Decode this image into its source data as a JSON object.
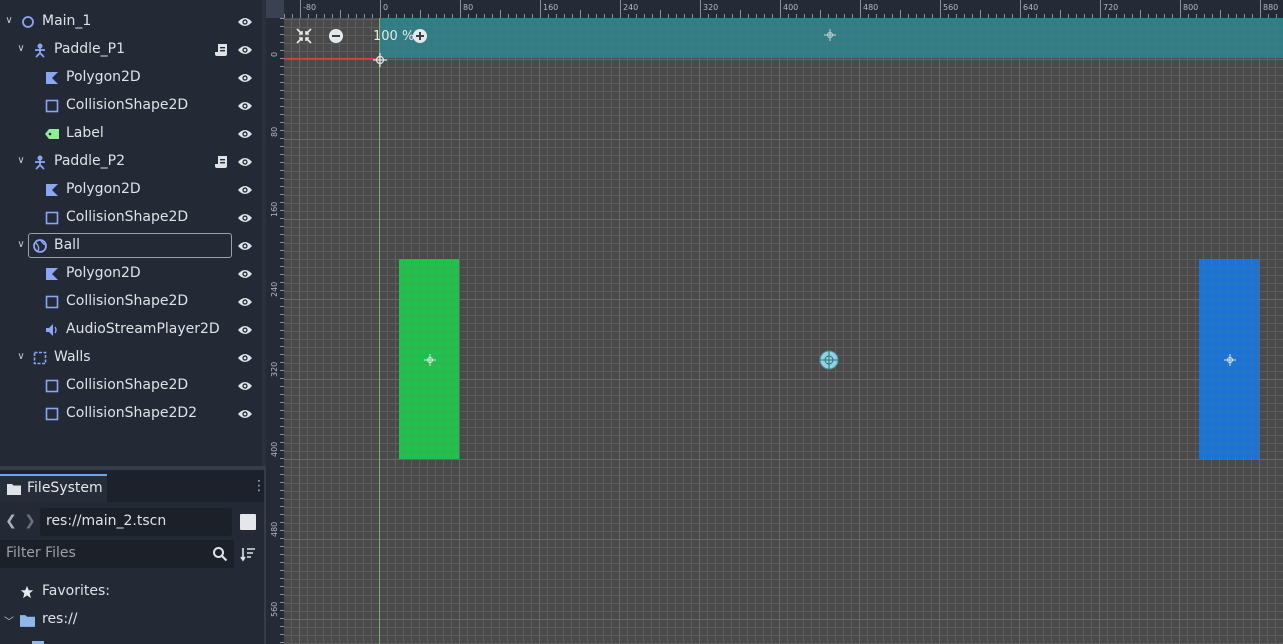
{
  "scene_tree": {
    "nodes": [
      {
        "label": "Main_1",
        "icon": "node2d-icon",
        "visible_icon": "eye-icon"
      },
      {
        "label": "Paddle_P1",
        "icon": "characterbody2d-icon",
        "has_script": true
      },
      {
        "label": "Polygon2D",
        "icon": "polygon2d-icon"
      },
      {
        "label": "CollisionShape2D",
        "icon": "collisionshape2d-icon"
      },
      {
        "label": "Label",
        "icon": "label-icon"
      },
      {
        "label": "Paddle_P2",
        "icon": "characterbody2d-icon",
        "has_script": true
      },
      {
        "label": "Polygon2D",
        "icon": "polygon2d-icon"
      },
      {
        "label": "CollisionShape2D",
        "icon": "collisionshape2d-icon"
      },
      {
        "label": "Ball",
        "icon": "rigidbody2d-icon",
        "selected": true
      },
      {
        "label": "Polygon2D",
        "icon": "polygon2d-icon"
      },
      {
        "label": "CollisionShape2D",
        "icon": "collisionshape2d-icon"
      },
      {
        "label": "AudioStreamPlayer2D",
        "icon": "audiostreamplayer2d-icon"
      },
      {
        "label": "Walls",
        "icon": "staticbody2d-icon"
      },
      {
        "label": "CollisionShape2D",
        "icon": "collisionshape2d-icon"
      },
      {
        "label": "CollisionShape2D2",
        "icon": "collisionshape2d-icon"
      }
    ]
  },
  "filesystem": {
    "tab_label": "FileSystem",
    "path": "res://main_2.tscn",
    "filter_placeholder": "Filter Files",
    "favorites_label": "Favorites:",
    "root_label": "res://"
  },
  "viewport": {
    "zoom_label": "100 %",
    "ruler_top_labels": [
      "-80",
      "0",
      "80",
      "160",
      "240",
      "320",
      "400",
      "480",
      "560",
      "640",
      "720",
      "800",
      "880"
    ],
    "ruler_left_labels": [
      "0",
      "80",
      "160",
      "240",
      "320",
      "400",
      "480",
      "560"
    ],
    "colors": {
      "paddle_p1": "#21c14b",
      "paddle_p2": "#1a74d6",
      "top_wall": "#2f7d85",
      "accent": "#6ea6e8"
    }
  }
}
